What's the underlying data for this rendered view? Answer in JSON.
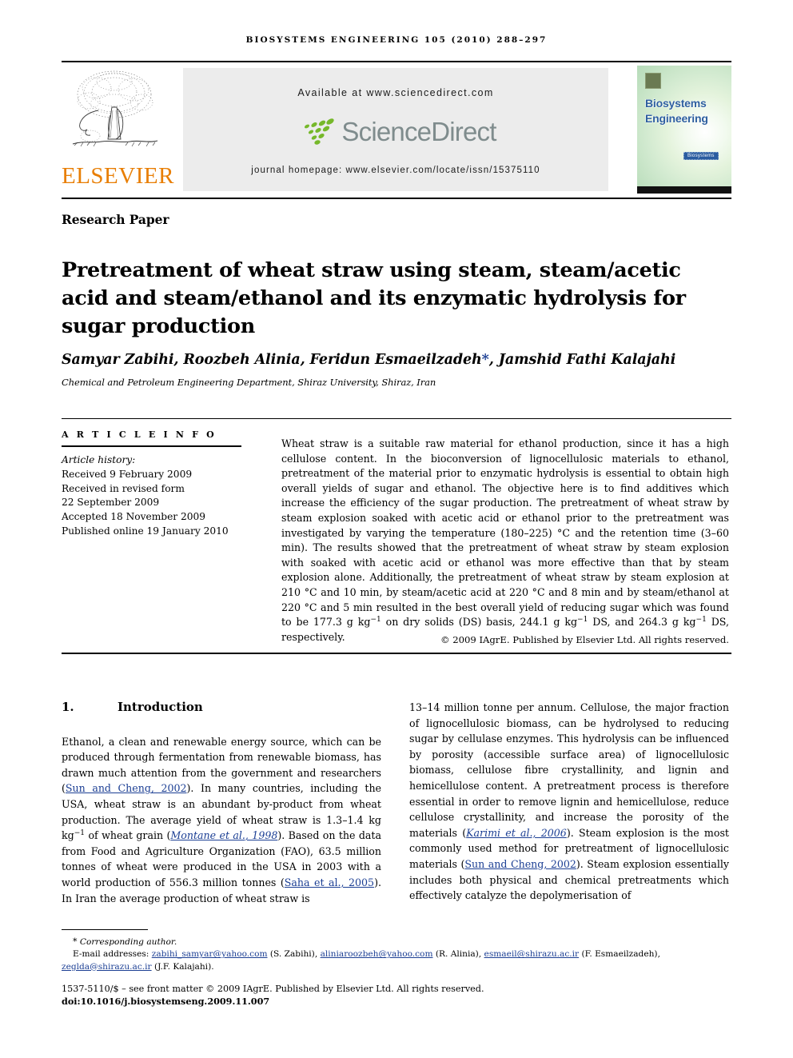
{
  "running_head": "BIOSYSTEMS ENGINEERING 105 (2010) 288–297",
  "masthead": {
    "publisher_name": "ELSEVIER",
    "publisher_color": "#E87E04",
    "available_at": "Available at www.sciencedirect.com",
    "sciencedirect_wordmark": "ScienceDirect",
    "sciencedirect_color": "#7f8c8d",
    "dot_color": "#76b82a",
    "journal_homepage": "journal homepage: www.elsevier.com/locate/issn/15375110",
    "cover": {
      "title": "Biosystems Engineering",
      "badge": "Biosystems",
      "title_color": "#2d5f9e"
    }
  },
  "article": {
    "paper_type": "Research Paper",
    "title": "Pretreatment of wheat straw using steam, steam/acetic acid and steam/ethanol and its enzymatic hydrolysis for sugar production",
    "authors": "Samyar Zabihi, Roozbeh Alinia, Feridun Esmaeilzadeh",
    "authors_tail": ", Jamshid Fathi Kalajahi",
    "corresponding_marker": "*",
    "affiliation": "Chemical and Petroleum Engineering Department, Shiraz University, Shiraz, Iran"
  },
  "article_info": {
    "heading": "A R T I C L E   I N F O",
    "history_label": "Article history:",
    "lines": [
      "Received 9 February 2009",
      "Received in revised form",
      "22 September 2009",
      "Accepted 18 November 2009",
      "Published online 19 January 2010"
    ]
  },
  "abstract": {
    "text": "Wheat straw is a suitable raw material for ethanol production, since it has a high cellulose content. In the bioconversion of lignocellulosic materials to ethanol, pretreatment of the material prior to enzymatic hydrolysis is essential to obtain high overall yields of sugar and ethanol. The objective here is to find additives which increase the efficiency of the sugar production. The pretreatment of wheat straw by steam explosion soaked with acetic acid or ethanol prior to the pretreatment was investigated by varying the temperature (180–225) °C and the retention time (3–60 min). The results showed that the pretreatment of wheat straw by steam explosion with soaked with acetic acid or ethanol was more effective than that by steam explosion alone. Additionally, the pretreatment of wheat straw by steam explosion at 210 °C and 10 min, by steam/acetic acid at 220 °C and 8 min and by steam/ethanol at 220 °C and 5 min resulted in the best overall yield of reducing sugar which was found to be 177.3 g kg",
    "sup1": "−1",
    "text2": " on dry solids (DS) basis, 244.1 g kg",
    "sup2": "−1",
    "text3": " DS, and 264.3 g kg",
    "sup3": "−1",
    "text4": " DS, respectively.",
    "copyright": "© 2009 IAgrE. Published by Elsevier Ltd. All rights reserved."
  },
  "body": {
    "section_number": "1.",
    "section_title": "Introduction",
    "left_p1_a": "Ethanol, a clean and renewable energy source, which can be produced through fermentation from renewable biomass, has drawn much attention from the government and researchers (",
    "left_cite1": "Sun and Cheng, 2002",
    "left_p1_b": "). In many countries, including the USA, wheat straw is an abundant by-product from wheat production. The average yield of wheat straw is 1.3–1.4 kg kg",
    "left_sup1": "−1",
    "left_p1_c": " of wheat grain (",
    "left_cite2": "Montane et al., 1998",
    "left_p1_d": "). Based on the data from Food and Agriculture Organization (FAO), 63.5 million tonnes of wheat were produced in the USA in 2003 with a world production of 556.3 million tonnes (",
    "left_cite3": "Saha et al., 2005",
    "left_p1_e": "). In Iran the average production of wheat straw is",
    "right_p1_a": "13–14 million tonne per annum. Cellulose, the major fraction of lignocellulosic biomass, can be hydrolysed to reducing sugar by cellulase enzymes. This hydrolysis can be influenced by porosity (accessible surface area) of lignocellulosic biomass, cellulose fibre crystallinity, and lignin and hemicellulose content. A pretreatment process is therefore essential in order to remove lignin and hemicellulose, reduce cellulose crystallinity, and increase the porosity of the materials (",
    "right_cite1": "Karimi et al., 2006",
    "right_p1_b": "). Steam explosion is the most commonly used method for pretreatment of lignocellulosic materials (",
    "right_cite2": "Sun and Cheng, 2002",
    "right_p1_c": "). Steam explosion essentially includes both physical and chemical pretreatments which effectively catalyze the depolymerisation of"
  },
  "footnote": {
    "corresponding_star": "*",
    "corresponding": "Corresponding author.",
    "email_label": "E-mail addresses:",
    "emails": [
      {
        "address": "zabihi_samyar@yahoo.com",
        "person": "(S. Zabihi)"
      },
      {
        "address": "aliniaroozbeh@yahoo.com",
        "person": "(R. Alinia)"
      },
      {
        "address": "esmaeil@shirazu.ac.ir",
        "person": "(F. Esmaeilzadeh)"
      },
      {
        "address": "zeglda@shirazu.ac.ir",
        "person": "(J.F. Kalajahi)"
      }
    ],
    "front_matter": "1537-5110/$ – see front matter © 2009 IAgrE. Published by Elsevier Ltd. All rights reserved.",
    "doi": "doi:10.1016/j.biosystemseng.2009.11.007"
  },
  "colors": {
    "link": "#1c3f94",
    "elsevier_orange": "#E87E04",
    "sciencedirect_green": "#76b82a",
    "banner_gray": "#ececec"
  }
}
